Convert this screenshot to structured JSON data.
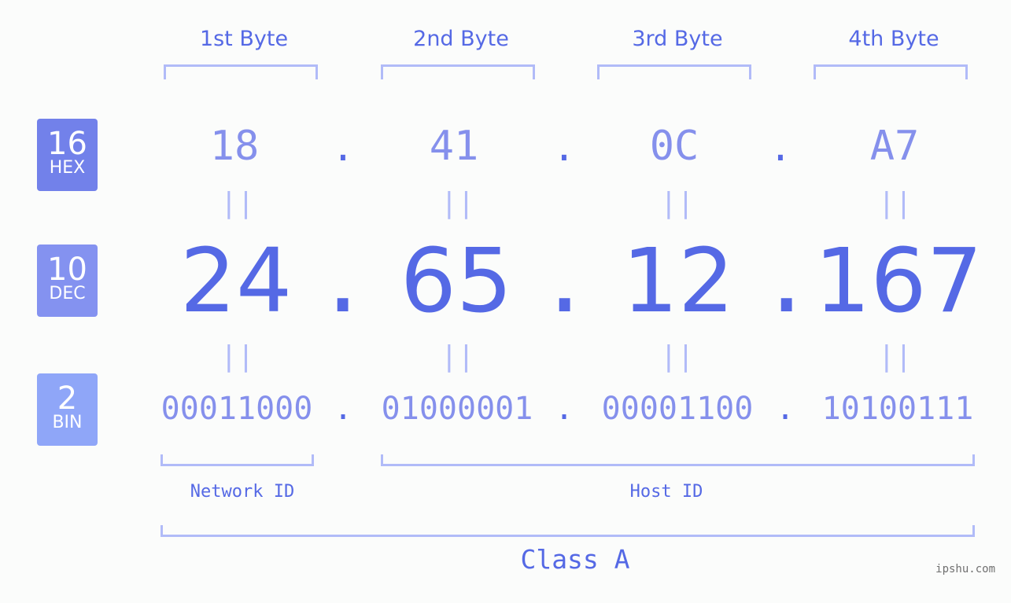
{
  "bytes": {
    "labels": [
      "1st Byte",
      "2nd Byte",
      "3rd Byte",
      "4th Byte"
    ]
  },
  "badges": {
    "hex": {
      "num": "16",
      "label": "HEX",
      "color": "#7281ea"
    },
    "dec": {
      "num": "10",
      "label": "DEC",
      "color": "#8492f0"
    },
    "bin": {
      "num": "2",
      "label": "BIN",
      "color": "#8fa6f8"
    }
  },
  "hex_values": [
    "18",
    "41",
    "0C",
    "A7"
  ],
  "dec_values": [
    "24",
    "65",
    "12",
    "167"
  ],
  "bin_values": [
    "00011000",
    "01000001",
    "00001100",
    "10100111"
  ],
  "separator": ".",
  "equals": "||",
  "network_id_label": "Network ID",
  "host_id_label": "Host ID",
  "class_label": "Class A",
  "watermark": "ipshu.com",
  "colors": {
    "accent": "#5569e5",
    "light_value": "#8590ec",
    "bracket": "#b1bbf8"
  }
}
